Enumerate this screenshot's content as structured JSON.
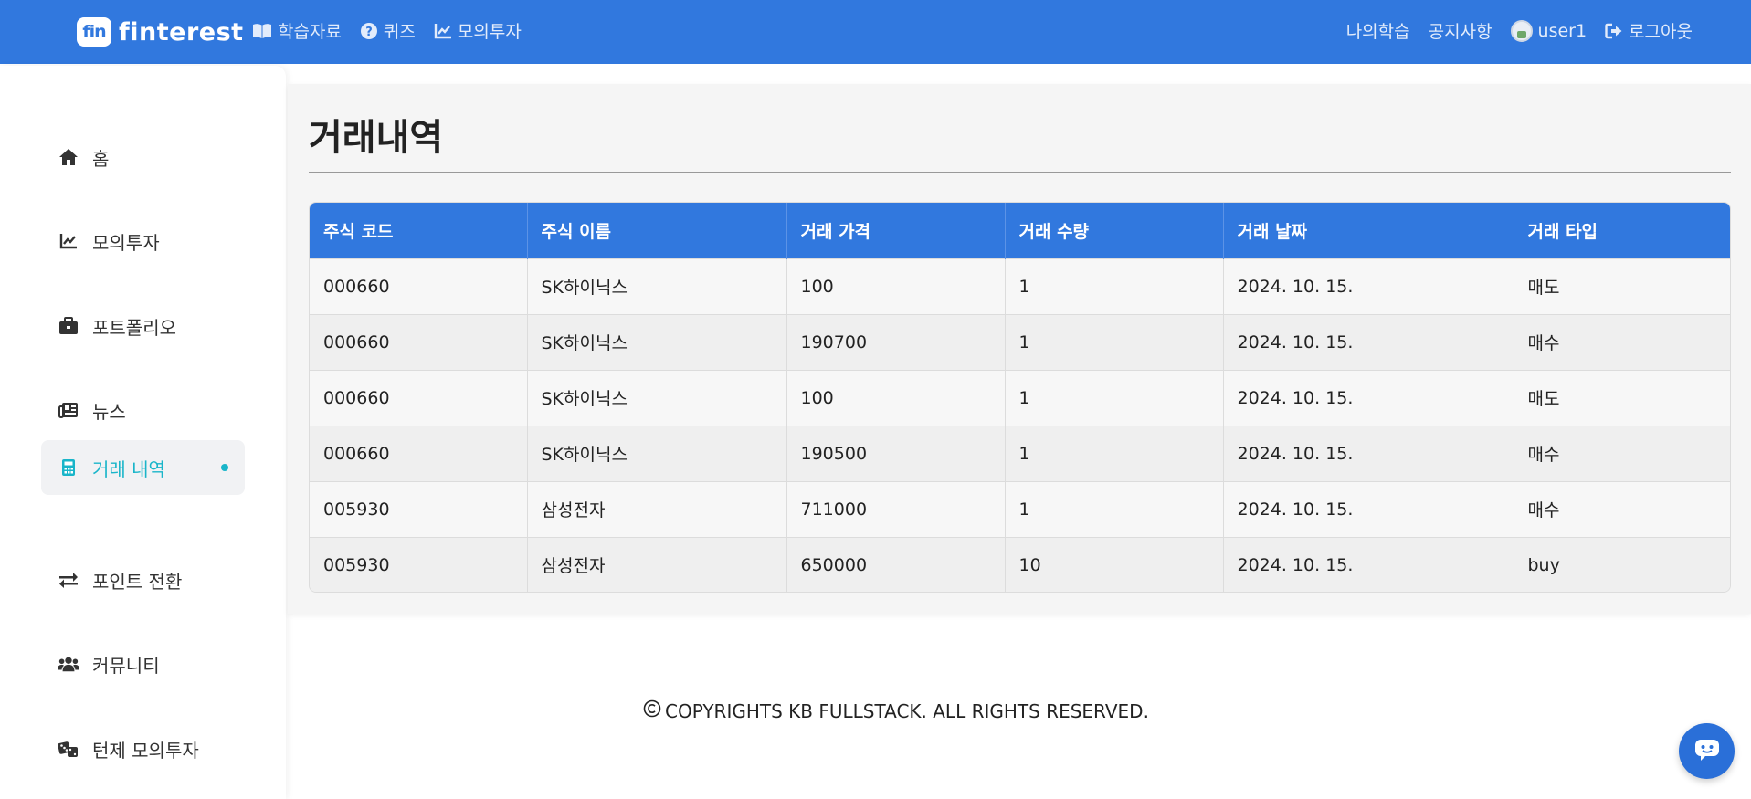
{
  "brand": {
    "badge": "fin",
    "name": "finterest"
  },
  "nav": {
    "left": [
      {
        "label": "학습자료",
        "icon": "book-icon"
      },
      {
        "label": "퀴즈",
        "icon": "question-circle-icon"
      },
      {
        "label": "모의투자",
        "icon": "chart-line-icon"
      }
    ],
    "right": {
      "my_learning": "나의학습",
      "notice": "공지사항",
      "user": "user1",
      "logout": "로그아웃"
    }
  },
  "sidebar": {
    "items": [
      {
        "label": "홈",
        "icon": "home-icon"
      },
      {
        "label": "모의투자",
        "icon": "chart-line-icon"
      },
      {
        "label": "포트폴리오",
        "icon": "briefcase-icon"
      },
      {
        "label": "뉴스",
        "icon": "newspaper-icon"
      },
      {
        "label": "거래 내역",
        "icon": "calculator-icon",
        "active": true
      },
      {
        "label": "포인트 전환",
        "icon": "exchange-icon"
      },
      {
        "label": "커뮤니티",
        "icon": "users-icon"
      },
      {
        "label": "턴제 모의투자",
        "icon": "dice-icon"
      }
    ],
    "active_color": "#19b5c9"
  },
  "page": {
    "title": "거래내역"
  },
  "table": {
    "headers": [
      "주식 코드",
      "주식 이름",
      "거래 가격",
      "거래 수량",
      "거래 날짜",
      "거래 타입"
    ],
    "rows": [
      [
        "000660",
        "SK하이닉스",
        "100",
        "1",
        "2024. 10. 15.",
        "매도"
      ],
      [
        "000660",
        "SK하이닉스",
        "190700",
        "1",
        "2024. 10. 15.",
        "매수"
      ],
      [
        "000660",
        "SK하이닉스",
        "100",
        "1",
        "2024. 10. 15.",
        "매도"
      ],
      [
        "000660",
        "SK하이닉스",
        "190500",
        "1",
        "2024. 10. 15.",
        "매수"
      ],
      [
        "005930",
        "삼성전자",
        "711000",
        "1",
        "2024. 10. 15.",
        "매수"
      ],
      [
        "005930",
        "삼성전자",
        "650000",
        "10",
        "2024. 10. 15.",
        "buy"
      ]
    ]
  },
  "footer": {
    "text": "COPYRIGHTS KB FULLSTACK. ALL RIGHTS RESERVED."
  },
  "colors": {
    "primary": "#3178de",
    "accent": "#19b5c9"
  }
}
